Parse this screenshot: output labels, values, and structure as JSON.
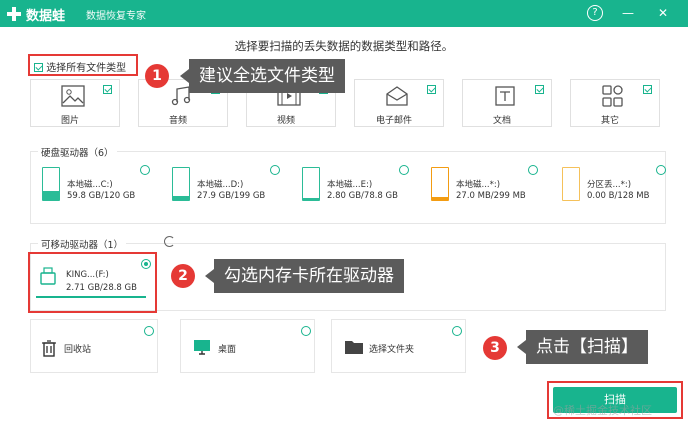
{
  "app": {
    "name": "数据蛙",
    "subtitle": "数据恢复专家",
    "help": "?",
    "minimize": "—",
    "close": "✕"
  },
  "instruction": "选择要扫描的丢失数据的数据类型和路径。",
  "select_all": {
    "label": "选择所有文件类型",
    "checked": true
  },
  "file_types": [
    {
      "label": "图片",
      "icon": "image-icon",
      "checked": true
    },
    {
      "label": "音频",
      "icon": "music-icon",
      "checked": true
    },
    {
      "label": "视频",
      "icon": "video-icon",
      "checked": true
    },
    {
      "label": "电子邮件",
      "icon": "mail-icon",
      "checked": true
    },
    {
      "label": "文档",
      "icon": "document-icon",
      "checked": true
    },
    {
      "label": "其它",
      "icon": "others-icon",
      "checked": true
    }
  ],
  "hard_drives": {
    "title": "硬盘驱动器（6）",
    "items": [
      {
        "name": "本地磁...C:)",
        "size": "59.8 GB/120 GB",
        "fill": 0.5
      },
      {
        "name": "本地磁...D:)",
        "size": "27.9 GB/199 GB",
        "fill": 0.14
      },
      {
        "name": "本地磁...E:)",
        "size": "2.80 GB/78.8 GB",
        "fill": 0.04
      },
      {
        "name": "本地磁...*:)",
        "size": "27.0 MB/299 MB",
        "fill": 0.09
      },
      {
        "name": "分区丢...*:)",
        "size": "0.00  B/128 MB",
        "fill": 0.0
      }
    ]
  },
  "removable": {
    "title": "可移动驱动器（1）",
    "items": [
      {
        "name": "KING...(F:)",
        "size": "2.71 GB/28.8 GB",
        "selected": true,
        "fill": 0.09
      }
    ]
  },
  "locations": [
    {
      "label": "回收站",
      "icon": "recycle-bin-icon"
    },
    {
      "label": "桌面",
      "icon": "desktop-icon"
    },
    {
      "label": "选择文件夹",
      "icon": "folder-icon"
    }
  ],
  "scan_button": "扫描",
  "annotations": [
    {
      "step": "1",
      "text": "建议全选文件类型"
    },
    {
      "step": "2",
      "text": "勾选内存卡所在驱动器"
    },
    {
      "step": "3",
      "text": "点击【扫描】"
    }
  ],
  "watermark": "@稀土掘金技术社区",
  "colors": {
    "brand": "#18b48e",
    "highlight": "#e53935",
    "tooltip": "#5b5b5b"
  }
}
